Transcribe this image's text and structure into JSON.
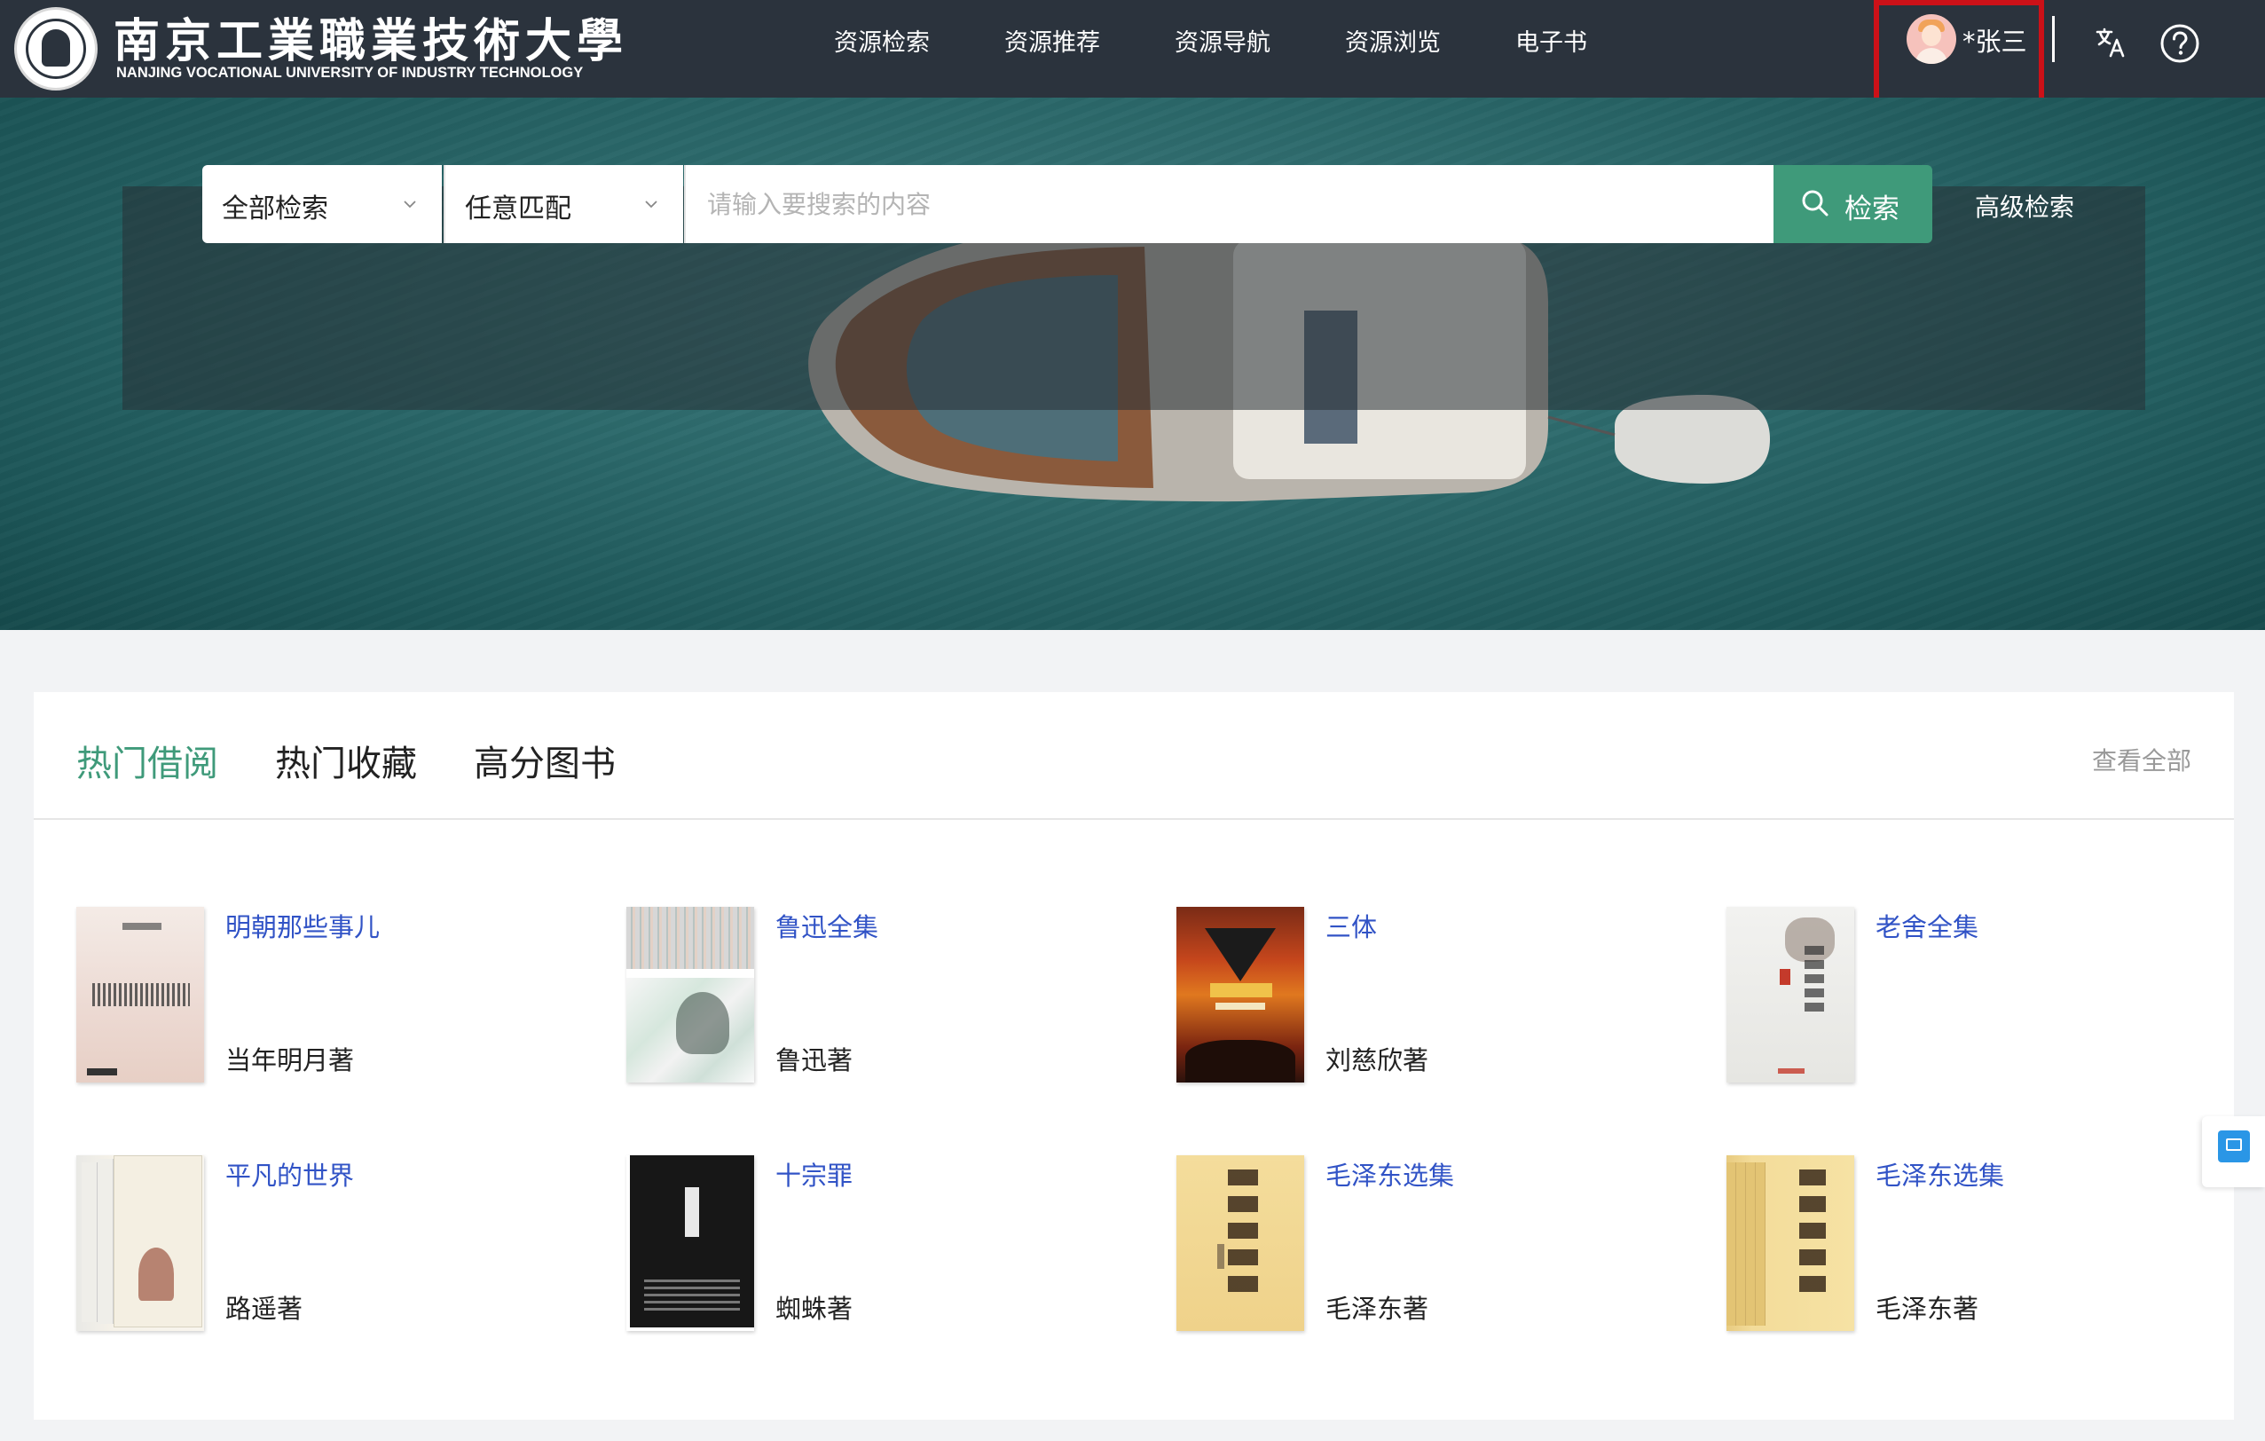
{
  "header": {
    "school_name_cn": "南京工業職業技術大學",
    "school_name_en": "NANJING VOCATIONAL UNIVERSITY OF INDUSTRY TECHNOLOGY",
    "nav": [
      {
        "label": "资源检索"
      },
      {
        "label": "资源推荐"
      },
      {
        "label": "资源导航"
      },
      {
        "label": "资源浏览"
      },
      {
        "label": "电子书"
      }
    ],
    "user": {
      "name": "*张三",
      "avatar_icon": "avatar-icon"
    },
    "icons": {
      "translate": "translate-icon",
      "help": "help-icon"
    },
    "highlight_color": "#cc1118",
    "bg_color": "#2b333d"
  },
  "search": {
    "scope": {
      "selected": "全部检索",
      "icon": "chevron-down-icon"
    },
    "match": {
      "selected": "任意匹配",
      "icon": "chevron-down-icon"
    },
    "placeholder": "请输入要搜索的内容",
    "value": "",
    "button_label": "检索",
    "button_icon": "search-icon",
    "advanced_label": "高级检索",
    "accent_color": "#3f9a7a"
  },
  "content": {
    "tabs": [
      {
        "label": "热门借阅",
        "active": true
      },
      {
        "label": "热门收藏",
        "active": false
      },
      {
        "label": "高分图书",
        "active": false
      }
    ],
    "view_all": "查看全部",
    "books": [
      {
        "title": "明朝那些事儿",
        "author": "当年明月著"
      },
      {
        "title": "鲁迅全集",
        "author": "鲁迅著"
      },
      {
        "title": "三体",
        "author": "刘慈欣著"
      },
      {
        "title": "老舍全集",
        "author": ""
      },
      {
        "title": "平凡的世界",
        "author": "路遥著"
      },
      {
        "title": "十宗罪",
        "author": "蜘蛛著"
      },
      {
        "title": "毛泽东选集",
        "author": "毛泽东著"
      },
      {
        "title": "毛泽东选集",
        "author": "毛泽东著"
      }
    ]
  },
  "side_widget": {
    "icon": "chat-icon"
  }
}
